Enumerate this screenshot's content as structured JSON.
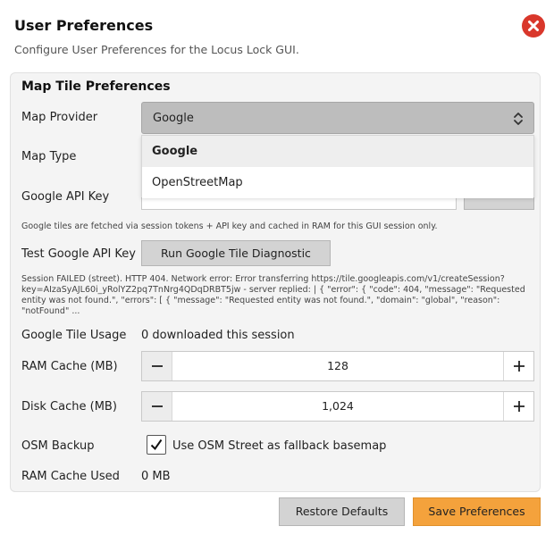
{
  "dialog": {
    "title": "User Preferences",
    "subtitle": "Configure User Preferences for the Locus Lock GUI.",
    "close_icon": "close-icon",
    "close_color": "#d9372b"
  },
  "panel": {
    "title": "Map Tile Preferences"
  },
  "map_provider": {
    "label": "Map Provider",
    "selected": "Google",
    "options": [
      "Google",
      "OpenStreetMap"
    ]
  },
  "map_type": {
    "label": "Map Type"
  },
  "api_key": {
    "label": "Google API Key",
    "value": "",
    "note": "Google tiles are fetched via session tokens + API key and cached in RAM for this GUI session only."
  },
  "test_key": {
    "label": "Test Google API Key",
    "button": "Run Google Tile Diagnostic",
    "result": "Session FAILED (street). HTTP 404. Network error: Error transferring https://tile.googleapis.com/v1/createSession?key=AIzaSyAJL60i_yRolYZ2pq7TnNrg4QDqDRBT5jw - server replied: | {   \"error\": {     \"code\": 404,     \"message\": \"Requested entity was not found.\",     \"errors\": [       {         \"message\": \"Requested entity was not found.\",         \"domain\": \"global\",         \"reason\": \"notFound\"    ..."
  },
  "tile_usage": {
    "label": "Google Tile Usage",
    "value": "0 downloaded this session"
  },
  "ram_cache": {
    "label": "RAM Cache (MB)",
    "value": "128"
  },
  "disk_cache": {
    "label": "Disk Cache (MB)",
    "value": "1,024"
  },
  "osm_backup": {
    "label": "OSM Backup",
    "checked": true,
    "checkbox_label": "Use OSM Street as fallback basemap"
  },
  "ram_used": {
    "label": "RAM Cache Used",
    "value": "0 MB"
  },
  "footer": {
    "restore_label": "Restore Defaults",
    "save_label": "Save Preferences",
    "save_color": "#f4a23c"
  }
}
